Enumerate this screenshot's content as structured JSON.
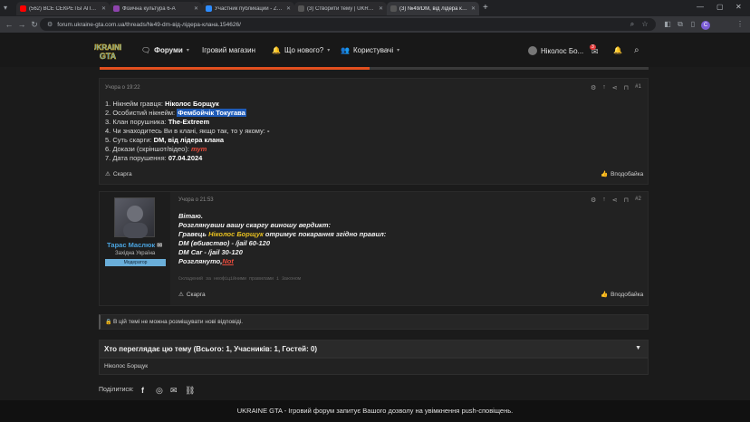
{
  "browser": {
    "tabs": [
      {
        "label": "(562) ВСЕ СЕКРЕТЫ АПРЕЛЯ",
        "color": "#ff0000"
      },
      {
        "label": "Фізична культура 6-А",
        "color": "#8e44ad"
      },
      {
        "label": "Участник публикации - Zoom",
        "color": "#2d8cff"
      },
      {
        "label": "(3) Створити тему | UKRAINE G...",
        "color": "#555555"
      },
      {
        "label": "(3) №49/DM, від лідера клан...",
        "color": "#555555"
      }
    ],
    "new_tab": "+",
    "url": "forum.ukraine-gta.com.ua/threads/№49-dm-від-лідера-клана.154626/",
    "profile_letter": "C"
  },
  "header": {
    "logo_line1": "UKRAINE",
    "logo_line2": "GTA",
    "nav": [
      {
        "label": "Форуми",
        "icon": "chat-icon"
      },
      {
        "label": "Ігровий магазин",
        "icon": ""
      },
      {
        "label": "Що нового?",
        "icon": "bell-icon"
      },
      {
        "label": "Користувачі",
        "icon": "users-icon"
      }
    ],
    "username": "Ніколос Бо...",
    "inbox_badge": "3"
  },
  "post1": {
    "time": "Учора о 19:22",
    "number": "#1",
    "lines": [
      {
        "label": "1. Нікнейм гравця: ",
        "value": "Ніколос Борщук"
      },
      {
        "label": "2. Особистий нікнейм: ",
        "value": "Фембойчік Токугава"
      },
      {
        "label": "3. Клан порушника: ",
        "value": "The-Extreem"
      },
      {
        "label": "4. Чи знаходитесь Ви в клані, якщо так, то у якому: ",
        "value": "-"
      },
      {
        "label": "5. Суть скарги: ",
        "value": "DM, від лідера клана"
      },
      {
        "label": "6. Докази (скріншот/відео): ",
        "value": "тут"
      },
      {
        "label": "7. Дата порушення: ",
        "value": "07.04.2024"
      }
    ],
    "report": "Скарга",
    "like": "Вподобайка"
  },
  "post2": {
    "author": "Тарас Маслюк",
    "location": "Західна Україна",
    "role": "Модератор",
    "time": "Учора о 21:53",
    "number": "#2",
    "greeting": "Вітаю.",
    "verdict": "Розглянувши вашу скаргу виношу вердикт:",
    "player_prefix": "Гравець ",
    "player": "Ніколос Борщук",
    "player_suffix": " отримує покарання згідно правил:",
    "rule1": "DM (вбивство) - /jail 60-120",
    "rule2": "DM Car - /jail 30-120",
    "status_prefix": "Розглянуто,",
    "status_value": "Not",
    "signature": "Складений за неофіційними правилами і Законом",
    "report": "Скарга",
    "like": "Вподобайка"
  },
  "thread": {
    "locked_notice": "В цій темі не можна розміщувати нові відповіді.",
    "viewers_title": "Хто переглядає цю тему (Всього: 1, Учасників: 1, Гостей: 0)",
    "viewers_list": "Ніколос Борщук",
    "share_label": "Поділитися:"
  },
  "push_notice": "UKRAINE GTA - Ігровий форум запитує Вашого дозволу на увімкнення push-сповіщень.",
  "colors": {
    "accent": "#e2501f",
    "highlight": "#1e5bb8",
    "link_red": "#e84b3c",
    "author_blue": "#4aa3df"
  }
}
